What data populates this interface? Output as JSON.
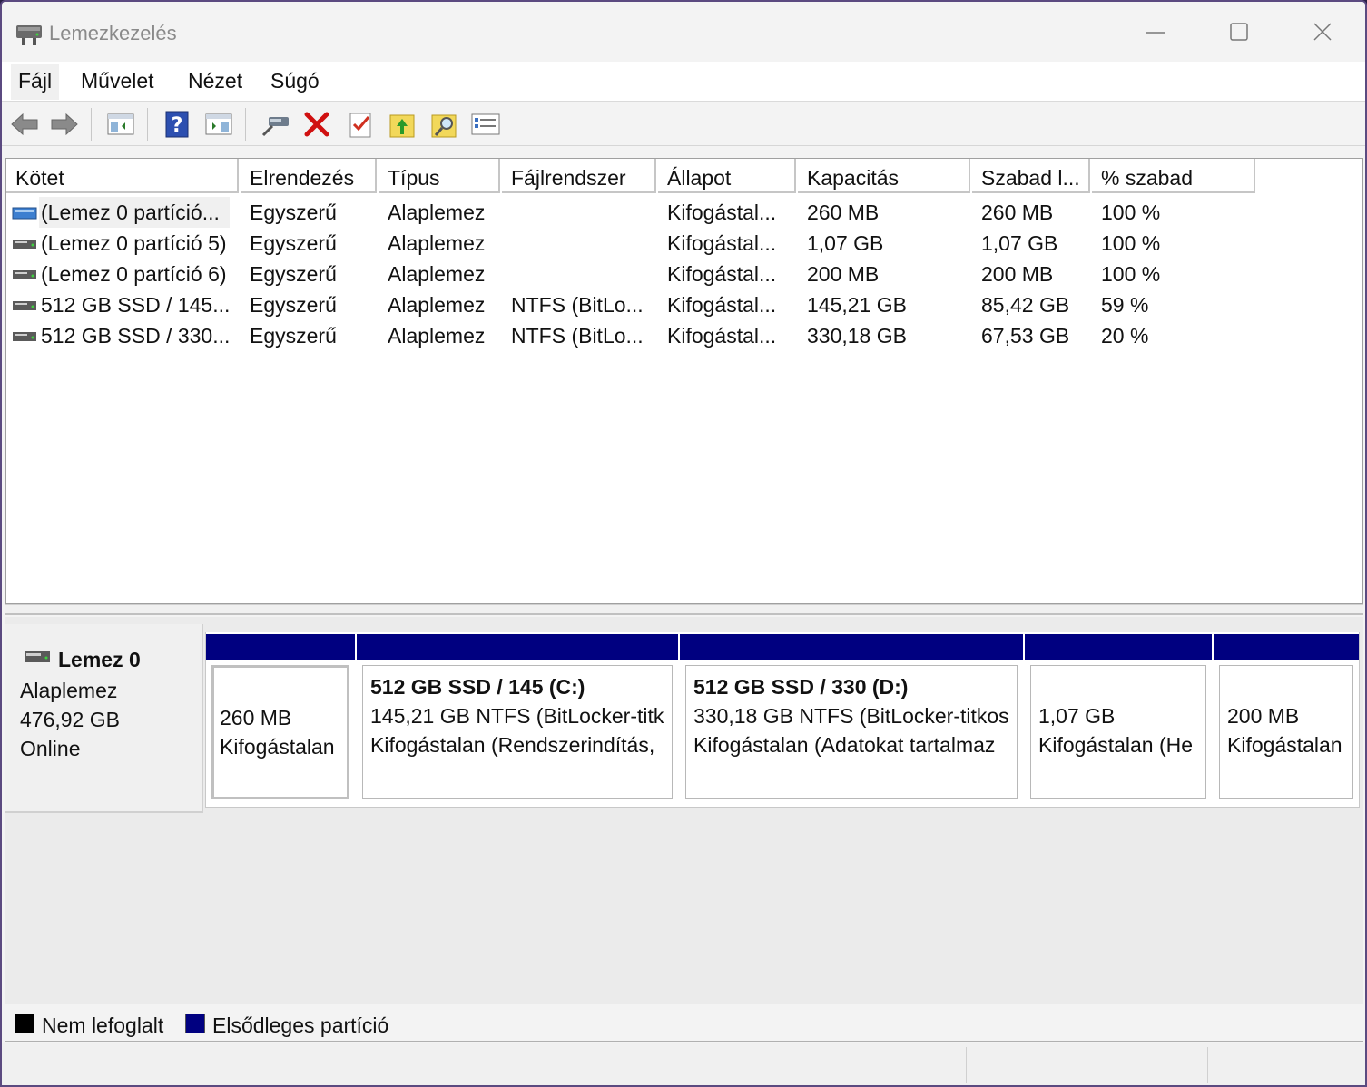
{
  "window": {
    "title": "Lemezkezelés"
  },
  "menu": [
    "Fájl",
    "Művelet",
    "Nézet",
    "Súgó"
  ],
  "toolbar": {
    "icons": [
      "back-icon",
      "forward-icon",
      "show-hide-console-tree-icon",
      "help-icon",
      "show-hide-action-pane-icon",
      "connect-virtual-disk-icon",
      "delete-icon",
      "checklist-icon",
      "open-folder-up-icon",
      "search-folder-icon",
      "properties-icon"
    ]
  },
  "volume_list": {
    "columns": [
      "Kötet",
      "Elrendezés",
      "Típus",
      "Fájlrendszer",
      "Állapot",
      "Kapacitás",
      "Szabad l...",
      "% szabad"
    ],
    "rows": [
      {
        "volume": "(Lemez 0 partíció...",
        "layout": "Egyszerű",
        "type": "Alaplemez",
        "fs": "",
        "status": "Kifogástal...",
        "capacity": "260 MB",
        "free": "260 MB",
        "pct": "100 %",
        "icon": "system-volume-icon"
      },
      {
        "volume": "(Lemez 0 partíció 5)",
        "layout": "Egyszerű",
        "type": "Alaplemez",
        "fs": "",
        "status": "Kifogástal...",
        "capacity": "1,07 GB",
        "free": "1,07 GB",
        "pct": "100 %",
        "icon": "volume-icon"
      },
      {
        "volume": "(Lemez 0 partíció 6)",
        "layout": "Egyszerű",
        "type": "Alaplemez",
        "fs": "",
        "status": "Kifogástal...",
        "capacity": "200 MB",
        "free": "200 MB",
        "pct": "100 %",
        "icon": "volume-icon"
      },
      {
        "volume": "512 GB SSD / 145...",
        "layout": "Egyszerű",
        "type": "Alaplemez",
        "fs": "NTFS (BitLo...",
        "status": "Kifogástal...",
        "capacity": "145,21 GB",
        "free": "85,42 GB",
        "pct": "59 %",
        "icon": "volume-icon"
      },
      {
        "volume": "512 GB SSD / 330...",
        "layout": "Egyszerű",
        "type": "Alaplemez",
        "fs": "NTFS (BitLo...",
        "status": "Kifogástal...",
        "capacity": "330,18 GB",
        "free": "67,53 GB",
        "pct": "20 %",
        "icon": "volume-icon"
      }
    ]
  },
  "disk": {
    "name": "Lemez 0",
    "type": "Alaplemez",
    "size": "476,92 GB",
    "state": "Online",
    "partitions": [
      {
        "title": "",
        "line1": "260 MB",
        "line2": "Kifogástalan"
      },
      {
        "title": "512 GB SSD / 145  (C:)",
        "line1": "145,21 GB NTFS (BitLocker-titk",
        "line2": "Kifogástalan (Rendszerindítás,"
      },
      {
        "title": "512 GB SSD / 330  (D:)",
        "line1": "330,18 GB NTFS (BitLocker-titkos",
        "line2": "Kifogástalan (Adatokat tartalmaz"
      },
      {
        "title": "",
        "line1": "1,07 GB",
        "line2": "Kifogástalan (He"
      },
      {
        "title": "",
        "line1": "200 MB",
        "line2": "Kifogástalan"
      }
    ]
  },
  "legend": {
    "items": [
      {
        "label": "Nem lefoglalt",
        "color": "#000000"
      },
      {
        "label": "Elsődleges partíció",
        "color": "#000080"
      }
    ]
  },
  "colors": {
    "partition_bar": "#000080",
    "unallocated": "#000000"
  }
}
